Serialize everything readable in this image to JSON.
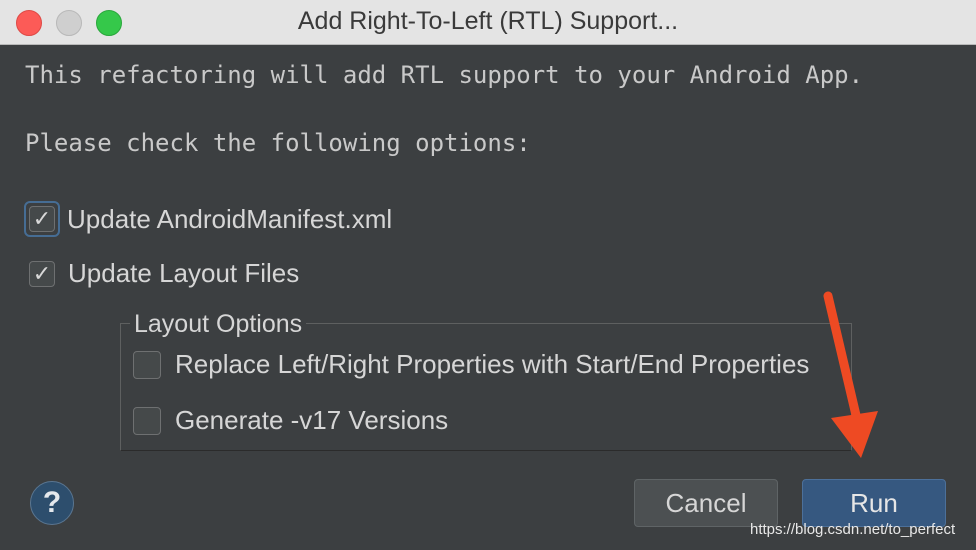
{
  "window": {
    "title": "Add Right-To-Left (RTL) Support..."
  },
  "message": {
    "line1": "This refactoring will add RTL support to your Android App.",
    "line2": "Please check the following options:"
  },
  "options": [
    {
      "label": "Update AndroidManifest.xml",
      "checked": true,
      "focused": true
    },
    {
      "label": "Update Layout Files",
      "checked": true
    }
  ],
  "layout_options": {
    "title": "Layout Options",
    "items": [
      {
        "label": "Replace Left/Right Properties with Start/End Properties",
        "checked": false
      },
      {
        "label": "Generate -v17 Versions",
        "checked": false
      }
    ]
  },
  "buttons": {
    "help": "?",
    "cancel": "Cancel",
    "run": "Run"
  },
  "watermark": "https://blog.csdn.net/to_perfect",
  "colors": {
    "background": "#3c3f41",
    "run_button": "#365880",
    "annotation_arrow": "#ee4a23"
  },
  "icons": {
    "checkbox_checked": "checkmark-icon",
    "help": "question-mark-icon",
    "annotation": "arrow-icon"
  }
}
